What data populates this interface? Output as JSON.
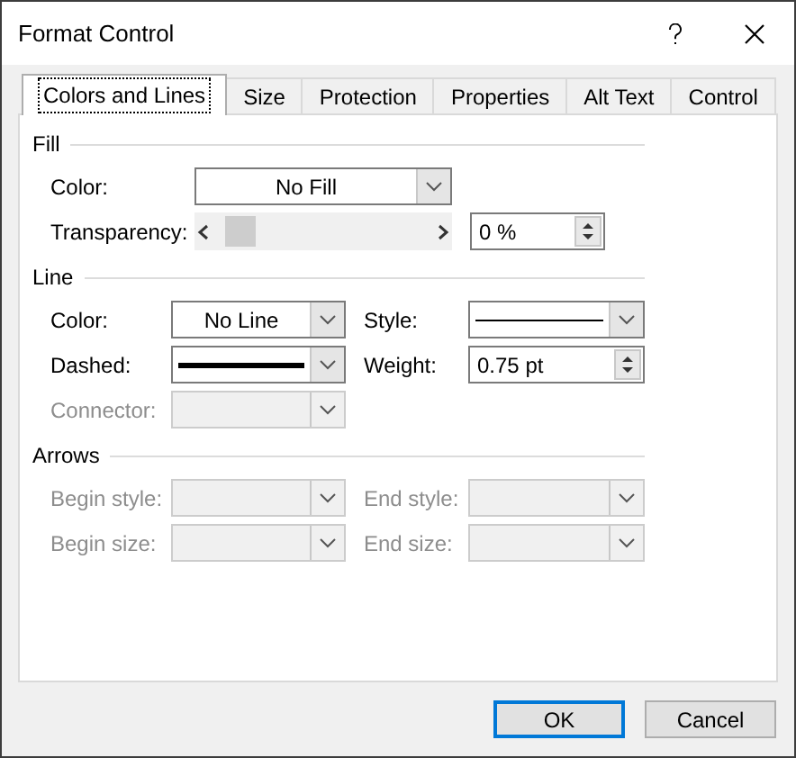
{
  "window": {
    "title": "Format Control"
  },
  "tabs": [
    {
      "label": "Colors and Lines",
      "selected": true
    },
    {
      "label": "Size",
      "selected": false
    },
    {
      "label": "Protection",
      "selected": false
    },
    {
      "label": "Properties",
      "selected": false
    },
    {
      "label": "Alt Text",
      "selected": false
    },
    {
      "label": "Control",
      "selected": false
    }
  ],
  "sections": [
    {
      "title": "Fill",
      "kind": "single",
      "rows": [
        [
          {
            "kind": "combo",
            "label": "Color:",
            "value": "No Fill",
            "disabled": false
          }
        ],
        [
          {
            "kind": "slider",
            "label": "Transparency:",
            "disabled": false
          },
          {
            "kind": "spin",
            "value": "0 %",
            "disabled": false
          }
        ]
      ]
    },
    {
      "title": "Line",
      "kind": "paired",
      "rows": [
        [
          {
            "kind": "combo",
            "label": "Color:",
            "value": "No Line",
            "disabled": false
          },
          {
            "kind": "thin_line_combo",
            "label": "Style:",
            "disabled": false
          }
        ],
        [
          {
            "kind": "thick_line_combo",
            "label": "Dashed:",
            "disabled": false
          },
          {
            "kind": "spin",
            "label": "Weight:",
            "value": "0.75 pt",
            "disabled": false
          }
        ],
        [
          {
            "kind": "combo",
            "label": "Connector:",
            "disabled": true
          }
        ]
      ]
    },
    {
      "title": "Arrows",
      "kind": "paired",
      "rows": [
        [
          {
            "kind": "combo",
            "label": "Begin style:",
            "disabled": true
          },
          {
            "kind": "combo",
            "label": "End style:",
            "disabled": true
          }
        ],
        [
          {
            "kind": "combo",
            "label": "Begin size:",
            "disabled": true
          },
          {
            "kind": "combo",
            "label": "End size:",
            "disabled": true
          }
        ]
      ]
    }
  ],
  "buttons": [
    {
      "label": "OK",
      "focused": true
    },
    {
      "label": "Cancel",
      "focused": false
    }
  ]
}
